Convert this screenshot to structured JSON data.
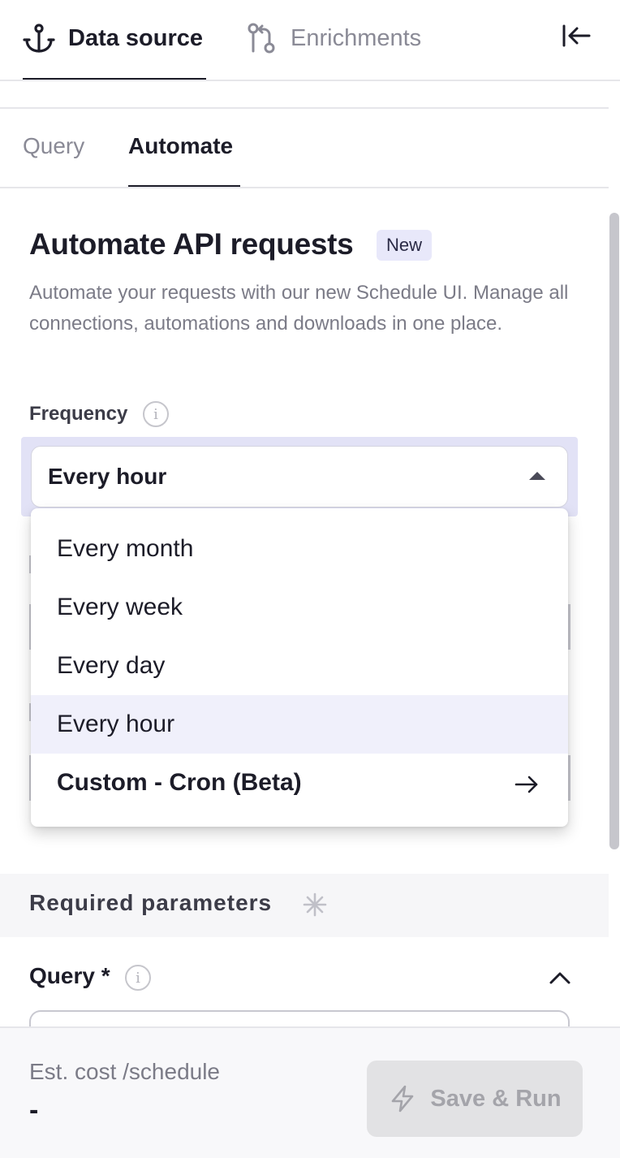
{
  "top_tabs": {
    "data_source": "Data source",
    "enrichments": "Enrichments"
  },
  "sub_tabs": {
    "query": "Query",
    "automate": "Automate"
  },
  "automate": {
    "title": "Automate API requests",
    "badge": "New",
    "description": "Automate your requests with our new Schedule UI. Manage all connections, automations and downloads in one place."
  },
  "frequency": {
    "label": "Frequency",
    "info_icon": "i",
    "selected": "Every hour",
    "options": [
      {
        "label": "Every month",
        "selected": false
      },
      {
        "label": "Every week",
        "selected": false
      },
      {
        "label": "Every day",
        "selected": false
      },
      {
        "label": "Every hour",
        "selected": true
      },
      {
        "label": "Custom - Cron (Beta)",
        "selected": false
      }
    ]
  },
  "required_parameters": {
    "title": "Required parameters",
    "query_label": "Query *",
    "info_icon": "i"
  },
  "footer": {
    "cost_label": "Est. cost /schedule",
    "cost_value": "-",
    "save_button": "Save & Run"
  },
  "colors": {
    "accent_ring": "#e2e2f6",
    "selected_option": "#f0f0fb",
    "badge": "#e8e8fa"
  }
}
